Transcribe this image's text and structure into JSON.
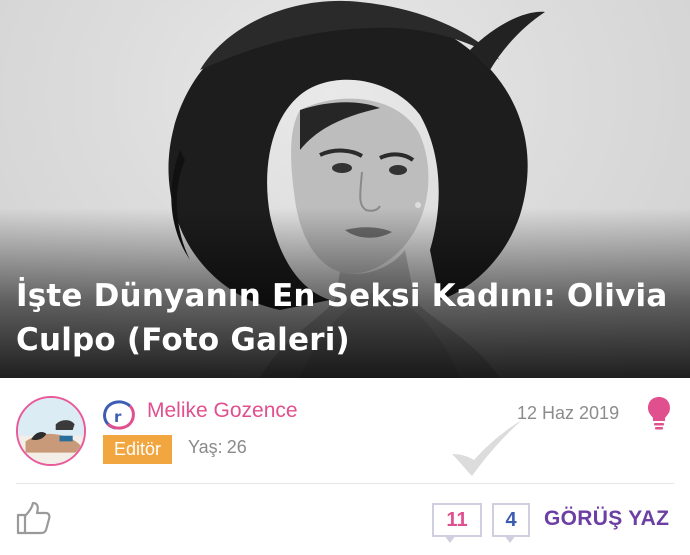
{
  "article": {
    "title": "İşte Dünyanın En Seksi Kadını: Olivia Culpo (Foto Galeri)",
    "image_icon": "portrait-photo"
  },
  "author": {
    "name": "Melike Gozence",
    "role": "Editör",
    "age_label": "Yaş:",
    "age_value": "26",
    "avatar_icon": "avatar",
    "brand_icon": "r-logo-icon"
  },
  "meta": {
    "date": "12 Haz 2019",
    "bulb_icon": "lightbulb-icon"
  },
  "actions": {
    "like_icon": "thumbs-up-icon",
    "views_count": "11",
    "comments_count": "4",
    "comment_button_label": "GÖRÜŞ YAZ"
  },
  "colors": {
    "accent_pink": "#e0508e",
    "badge_orange": "#f2a640",
    "comment_purple": "#6b3fa3",
    "count_blue": "#3c5cb4"
  }
}
